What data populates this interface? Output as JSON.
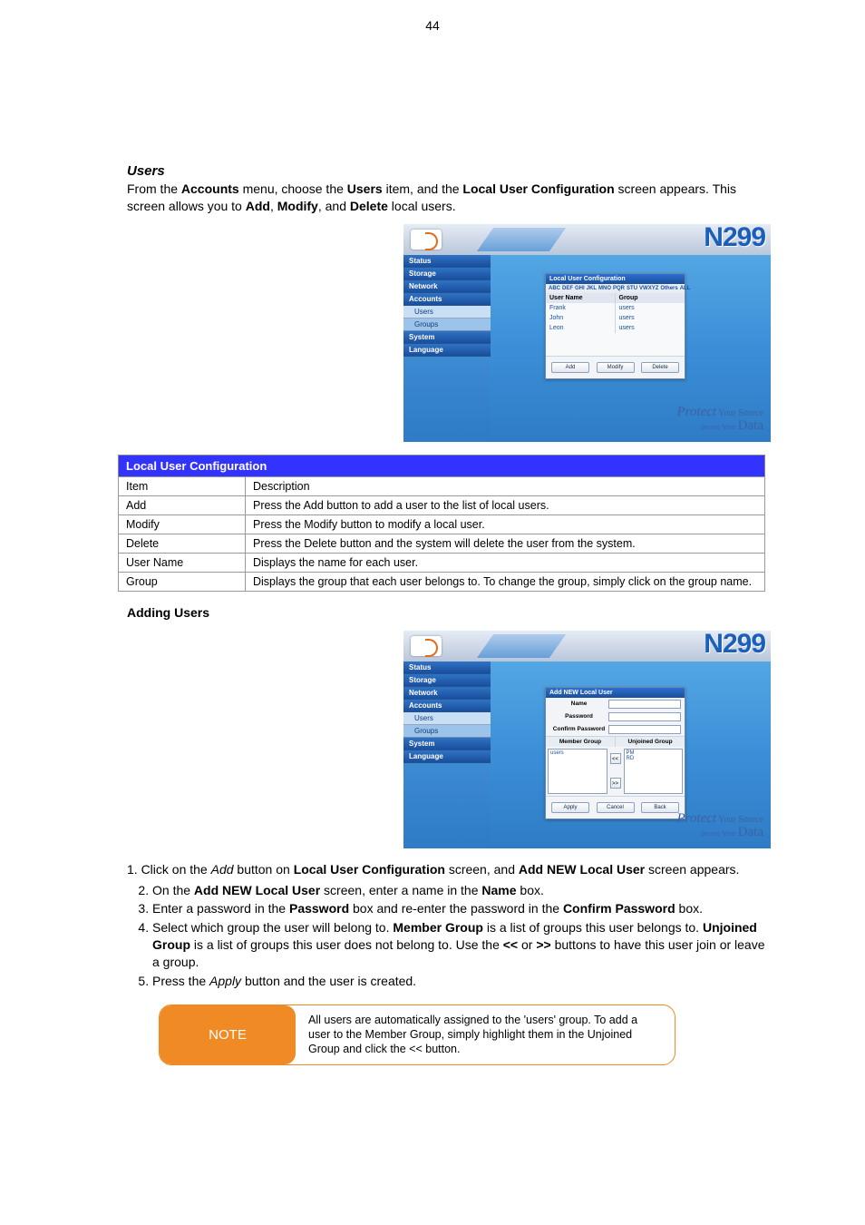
{
  "page_number": "44",
  "section_heading": "Users",
  "intro_paragraph_parts": [
    "From the ",
    "Accounts",
    " menu, choose the ",
    "Users",
    " item, and the ",
    "Local User Configuration",
    " screen appears. This screen allows you to ",
    "Add",
    ", ",
    "Modify",
    ", and ",
    "Delete",
    " local users."
  ],
  "screenshot1": {
    "model": "N299",
    "nav": {
      "items": [
        "Status",
        "Storage",
        "Network",
        "Accounts",
        "System",
        "Language"
      ],
      "sub_items": [
        "Users",
        "Groups"
      ],
      "selected_sub": "Users"
    },
    "panel_title": "Local User Configuration",
    "alpha": [
      "ABC",
      "DEF",
      "GHI",
      "JKL",
      "MNO",
      "PQR",
      "STU",
      "VWXYZ",
      "Others",
      "ALL"
    ],
    "columns": {
      "user": "User Name",
      "group": "Group"
    },
    "rows": [
      {
        "user": "Frank",
        "group": "users"
      },
      {
        "user": "John",
        "group": "users"
      },
      {
        "user": "Leon",
        "group": "users"
      }
    ],
    "buttons": {
      "add": "Add",
      "modify": "Modify",
      "delete": "Delete"
    },
    "footer": {
      "line1a": "Protect",
      "line1b": " Your Source",
      "line2a": "Secure Your ",
      "line2b": "Data"
    }
  },
  "desc_table": {
    "header": {
      "left": "Local User Configuration",
      "right": ""
    },
    "rows": [
      {
        "k": "Item",
        "v": "Description"
      },
      {
        "k": "Add",
        "v": "Press the Add button to add a user to the list of local users."
      },
      {
        "k": "Modify",
        "v": "Press the Modify button to modify a local user."
      },
      {
        "k": "Delete",
        "v": "Press the Delete button and the system will delete the user from the system."
      },
      {
        "k": "User Name",
        "v": "Displays the name for each user."
      },
      {
        "k": "Group",
        "v": "Displays the group that each user belongs to. To change the group, simply click on the group name."
      }
    ]
  },
  "add_user_heading": "Adding Users",
  "screenshot2": {
    "model": "N299",
    "nav": {
      "items": [
        "Status",
        "Storage",
        "Network",
        "Accounts",
        "System",
        "Language"
      ],
      "sub_items": [
        "Users",
        "Groups"
      ],
      "selected_sub": "Users"
    },
    "panel_title": "Add NEW Local User",
    "labels": {
      "name": "Name",
      "password": "Password",
      "confirm": "Confirm Password",
      "member": "Member Group",
      "unjoined": "Unjoined Group"
    },
    "member_list": [
      "users"
    ],
    "unjoined_list": [
      "PM",
      "RD"
    ],
    "buttons": {
      "apply": "Apply",
      "cancel": "Cancel",
      "back": "Back"
    },
    "footer": {
      "line1a": "Protect",
      "line1b": " Your Source",
      "line2a": "Secure Your ",
      "line2b": "Data"
    }
  },
  "steps": {
    "lead": [
      "1.  Click on the ",
      "Add",
      " button on ",
      "Local User Configuration",
      " screen, and ",
      "Add NEW Local User",
      " screen appears."
    ],
    "items": [
      {
        "n": "2",
        "parts": [
          "On the ",
          "Add NEW Local User",
          " screen, enter a name in the ",
          "Name",
          " box."
        ]
      },
      {
        "n": "3",
        "parts": [
          "Enter a password in the ",
          "Password",
          " box and re-enter the password in the ",
          "Confirm Password",
          " box."
        ]
      },
      {
        "n": "4",
        "parts": [
          "Select which group the user will belong to. ",
          "Member Group",
          " is a list of groups this user belongs to. ",
          "Unjoined Group",
          " is a list of groups this user does not belong to. Use the ",
          "<<",
          "  or  ",
          ">>",
          " buttons to have this user join or leave a group."
        ]
      },
      {
        "n": "5",
        "parts": [
          "Press the ",
          "Apply",
          " button and the user is created."
        ]
      }
    ]
  },
  "note": {
    "tag": "NOTE",
    "text": "All users are automatically assigned to the 'users' group. To add a user to the Member Group, simply highlight them in the Unjoined Group and click the << button."
  }
}
